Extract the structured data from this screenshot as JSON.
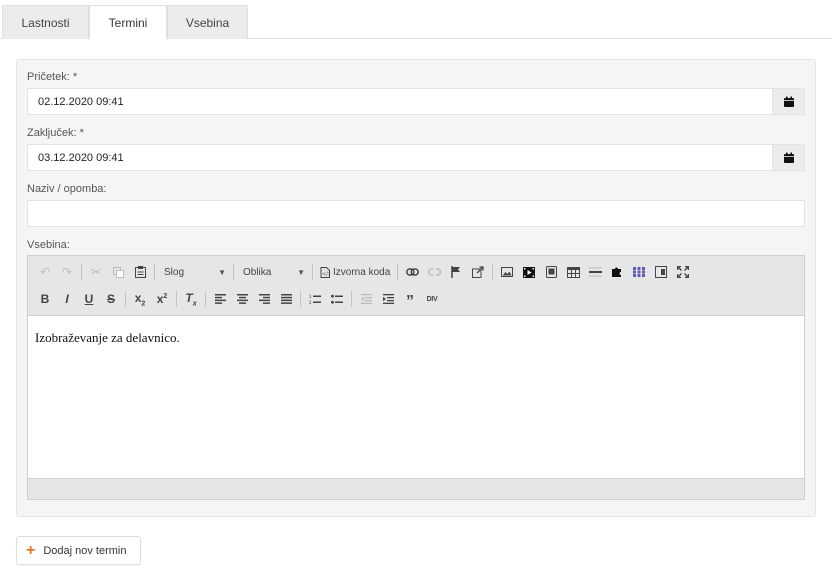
{
  "tabs": [
    {
      "label": "Lastnosti",
      "active": false
    },
    {
      "label": "Termini",
      "active": true
    },
    {
      "label": "Vsebina",
      "active": false
    }
  ],
  "form": {
    "start_label": "Pričetek: *",
    "start_value": "02.12.2020 09:41",
    "end_label": "Zaključek: *",
    "end_value": "03.12.2020 09:41",
    "name_label": "Naziv / opomba:",
    "name_value": "",
    "content_label": "Vsebina:"
  },
  "editor": {
    "style_combo": "Slog",
    "format_combo": "Oblika",
    "source_label": "Izvorna koda",
    "content_text": "Izobraževanje za delavnico."
  },
  "actions": {
    "add_label": "Dodaj nov termin"
  },
  "colors": {
    "accent": "#e8742a",
    "panel_bg": "#f5f5f5",
    "toolbar_bg": "#e6e6e6"
  }
}
